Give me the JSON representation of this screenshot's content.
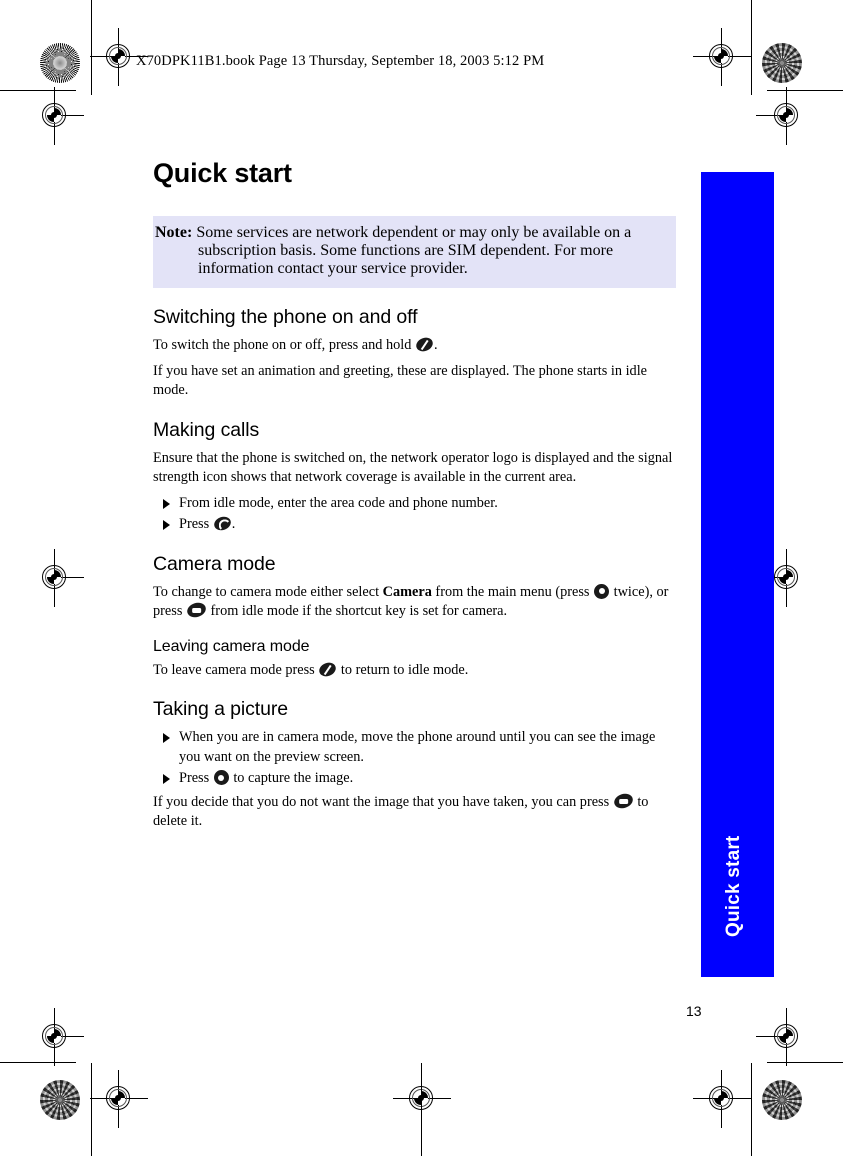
{
  "document": {
    "file_header": "X70DPK11B1.book  Page 13  Thursday, September 18, 2003  5:12 PM",
    "page_number": "13",
    "side_tab_label": "Quick start",
    "accent_color": "#0000FF",
    "note_background": "#E3E3F7"
  },
  "content": {
    "title": "Quick start",
    "note": {
      "label": "Note:",
      "text": "Some services are network dependent or may only be available on a subscription basis. Some functions are SIM dependent. For more information contact your service provider."
    },
    "sections": [
      {
        "heading": "Switching the phone on and off",
        "paragraph_1_before": "To switch the phone on or off, press and hold ",
        "paragraph_1_after": ".",
        "paragraph_2": "If you have set an animation and greeting, these are displayed. The phone starts in idle mode."
      },
      {
        "heading": "Making calls",
        "paragraph_1": "Ensure that the phone is switched on, the network operator logo is displayed and the signal strength icon shows that network coverage is available in the current area.",
        "step_1": "From idle mode, enter the area code and phone number.",
        "step_2_before": "Press ",
        "step_2_after": "."
      },
      {
        "heading": "Camera mode",
        "para_a": "To change to camera mode either select ",
        "para_bold": "Camera",
        "para_b": " from the main menu (press ",
        "para_c": " twice), or press ",
        "para_d": " from idle mode if the shortcut key is set for camera.",
        "subheading": "Leaving camera mode",
        "sub_para_before": "To leave camera mode press ",
        "sub_para_after": " to return to idle mode."
      },
      {
        "heading": "Taking a picture",
        "step_1": "When you are in camera mode, move the phone around until you can see the image you want on the preview screen.",
        "step_2_before": "Press ",
        "step_2_after": " to capture the image.",
        "paragraph_before": "If you decide that you do not want the image that you have taken, you can press ",
        "paragraph_after": " to delete it."
      }
    ]
  },
  "icons": {
    "power_key": "power-key-icon",
    "call_key": "call-key-icon",
    "select_key": "select-key-icon",
    "shortcut_key": "camera-shortcut-key-icon"
  }
}
